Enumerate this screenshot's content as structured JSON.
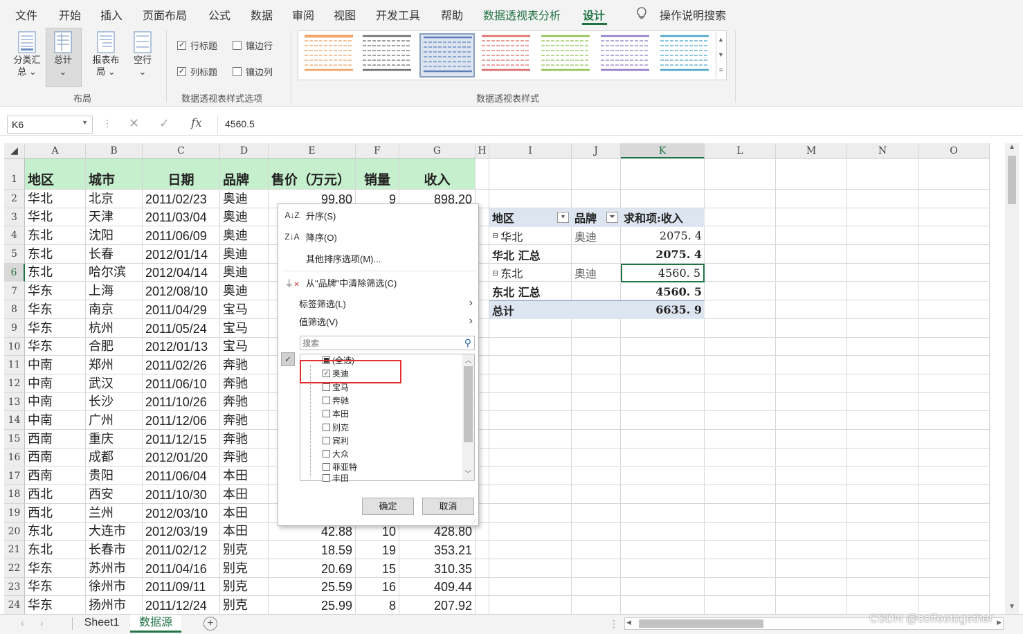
{
  "menu": {
    "items": [
      "文件",
      "开始",
      "插入",
      "页面布局",
      "公式",
      "数据",
      "审阅",
      "视图",
      "开发工具",
      "帮助"
    ],
    "pivot_analyze": "数据透视表分析",
    "design": "设计",
    "tell_me": "操作说明搜索"
  },
  "ribbon": {
    "subtotals": [
      "分类汇",
      "总"
    ],
    "grand_totals": "总计",
    "report_layout": [
      "报表布",
      "局"
    ],
    "blank_rows": "空行",
    "layout_group": "布局",
    "row_headers": "行标题",
    "banded_rows": "镶边行",
    "col_headers": "列标题",
    "banded_cols": "镶边列",
    "options_group": "数据透视表样式选项",
    "styles_group": "数据透视表样式",
    "style_colors": [
      "#f0a060",
      "#6b6b6b",
      "#5b7fb8",
      "#e06666",
      "#8fc04f",
      "#8e7cc3",
      "#4aa3c8"
    ]
  },
  "formula_bar": {
    "name_box": "K6",
    "fx": "fx",
    "formula": "4560.5"
  },
  "columns": [
    "A",
    "B",
    "C",
    "D",
    "E",
    "F",
    "G",
    "H",
    "I",
    "J",
    "K",
    "L",
    "M",
    "N",
    "O"
  ],
  "table": {
    "headers": [
      "地区",
      "城市",
      "日期",
      "品牌",
      "售价（万元）",
      "销量",
      "收入"
    ],
    "rows": [
      [
        "华北",
        "北京",
        "2011/02/23",
        "奥迪",
        "99.80",
        "9",
        "898.20"
      ],
      [
        "华北",
        "天津",
        "2011/03/04",
        "奥迪",
        "",
        "",
        ""
      ],
      [
        "东北",
        "沈阳",
        "2011/06/09",
        "奥迪",
        "",
        "",
        ""
      ],
      [
        "东北",
        "长春",
        "2012/01/14",
        "奥迪",
        "",
        "",
        ""
      ],
      [
        "东北",
        "哈尔滨",
        "2012/04/14",
        "奥迪",
        "",
        "",
        ""
      ],
      [
        "华东",
        "上海",
        "2012/08/10",
        "奥迪",
        "",
        "",
        ""
      ],
      [
        "华东",
        "南京",
        "2011/04/29",
        "宝马",
        "",
        "",
        ""
      ],
      [
        "华东",
        "杭州",
        "2011/05/24",
        "宝马",
        "",
        "",
        ""
      ],
      [
        "华东",
        "合肥",
        "2012/01/13",
        "宝马",
        "",
        "",
        ""
      ],
      [
        "中南",
        "郑州",
        "2011/02/26",
        "奔驰",
        "",
        "",
        ""
      ],
      [
        "中南",
        "武汉",
        "2011/06/10",
        "奔驰",
        "",
        "",
        ""
      ],
      [
        "中南",
        "长沙",
        "2011/10/26",
        "奔驰",
        "",
        "",
        ""
      ],
      [
        "中南",
        "广州",
        "2011/12/06",
        "奔驰",
        "",
        "",
        ""
      ],
      [
        "西南",
        "重庆",
        "2011/12/15",
        "奔驰",
        "",
        "",
        ""
      ],
      [
        "西南",
        "成都",
        "2012/01/20",
        "奔驰",
        "",
        "",
        ""
      ],
      [
        "西南",
        "贵阳",
        "2011/06/04",
        "本田",
        "",
        "",
        ""
      ],
      [
        "西北",
        "西安",
        "2011/10/30",
        "本田",
        "",
        "",
        ""
      ],
      [
        "西北",
        "兰州",
        "2012/03/10",
        "本田",
        "",
        "",
        ""
      ],
      [
        "东北",
        "大连市",
        "2012/03/19",
        "本田",
        "42.88",
        "10",
        "428.80"
      ],
      [
        "东北",
        "长春市",
        "2011/02/12",
        "别克",
        "18.59",
        "19",
        "353.21"
      ],
      [
        "华东",
        "苏州市",
        "2011/04/16",
        "别克",
        "20.69",
        "15",
        "310.35"
      ],
      [
        "华东",
        "徐州市",
        "2011/09/11",
        "别克",
        "25.59",
        "16",
        "409.44"
      ],
      [
        "华东",
        "扬州市",
        "2011/12/24",
        "别克",
        "25.99",
        "8",
        "207.92"
      ]
    ]
  },
  "pivot": {
    "h_region": "地区",
    "h_brand": "品牌",
    "h_sum": "求和项:收入",
    "rows": [
      {
        "region": "华北",
        "brand": "奥迪",
        "value": "2075. 4"
      },
      {
        "region": "华北 汇总",
        "brand": "",
        "value": "2075. 4"
      },
      {
        "region": "东北",
        "brand": "奥迪",
        "value": "4560. 5"
      },
      {
        "region": "东北 汇总",
        "brand": "",
        "value": "4560. 5"
      },
      {
        "region": "总计",
        "brand": "",
        "value": "6635. 9"
      }
    ]
  },
  "dropdown": {
    "sort_asc": "升序(S)",
    "sort_desc": "降序(O)",
    "more_sort": "其他排序选项(M)...",
    "clear_filter": "从\"品牌\"中清除筛选(C)",
    "label_filter": "标签筛选(L)",
    "value_filter": "值筛选(V)",
    "search_placeholder": "搜索",
    "list": [
      {
        "label": "(全选)",
        "state": "partial"
      },
      {
        "label": "奥迪",
        "state": "checked"
      },
      {
        "label": "宝马",
        "state": "unchecked"
      },
      {
        "label": "奔驰",
        "state": "unchecked"
      },
      {
        "label": "本田",
        "state": "unchecked"
      },
      {
        "label": "别克",
        "state": "unchecked"
      },
      {
        "label": "宾利",
        "state": "unchecked"
      },
      {
        "label": "大众",
        "state": "unchecked"
      },
      {
        "label": "菲亚特",
        "state": "unchecked"
      },
      {
        "label": "丰田",
        "state": "unchecked"
      }
    ],
    "ok": "确定",
    "cancel": "取消",
    "highlight_color": "#e03030"
  },
  "sheets": {
    "tabs": [
      "Sheet1",
      "数据源"
    ],
    "active": "数据源"
  },
  "watermark": "CSDN @coffeetogether"
}
